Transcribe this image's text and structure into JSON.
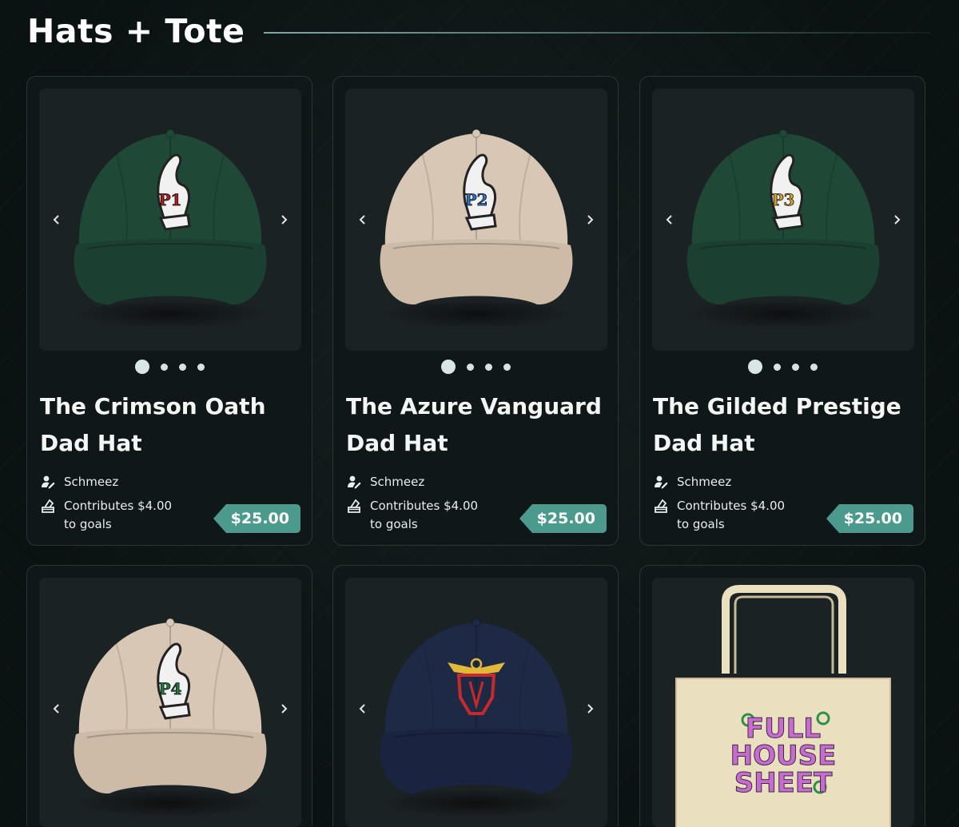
{
  "section": {
    "title": "Hats + Tote"
  },
  "products": [
    {
      "title": "The Crimson Oath Dad Hat",
      "creator": "Schmeez",
      "contribution": "Contributes $4.00 to goals",
      "price": "$25.00",
      "image_count": 4,
      "active_image": 1,
      "hat_color": "#1f4836",
      "brim_color": "#1b3f30",
      "patch_label": "P1",
      "patch_color": "#b01b1b"
    },
    {
      "title": "The Azure Vanguard Dad Hat",
      "creator": "Schmeez",
      "contribution": "Contributes $4.00 to goals",
      "price": "$25.00",
      "image_count": 4,
      "active_image": 1,
      "hat_color": "#d8c7b4",
      "brim_color": "#cdbba7",
      "patch_label": "P2",
      "patch_color": "#2f6fc4"
    },
    {
      "title": "The Gilded Prestige Dad Hat",
      "creator": "Schmeez",
      "contribution": "Contributes $4.00 to goals",
      "price": "$25.00",
      "image_count": 4,
      "active_image": 1,
      "hat_color": "#1f4836",
      "brim_color": "#1b3f30",
      "patch_label": "P3",
      "patch_color": "#d4a824"
    },
    {
      "hat_color": "#d8c7b4",
      "brim_color": "#cdbba7",
      "patch_label": "P4",
      "patch_color": "#1f7a3c"
    },
    {
      "hat_color": "#1e2a45",
      "brim_color": "#1a2440",
      "emblem": "red-winged-helmet"
    },
    {
      "bag_color": "#eadfbf",
      "print_lines": [
        "FULL",
        "HOUSE",
        "SHEET"
      ],
      "print_color": "#c86bd0",
      "accent_color": "#2f8f4a"
    }
  ],
  "icons": {
    "creator": "user-pen-icon",
    "contribution": "donation-box-icon",
    "prev": "chevron-left-icon",
    "next": "chevron-right-icon"
  }
}
